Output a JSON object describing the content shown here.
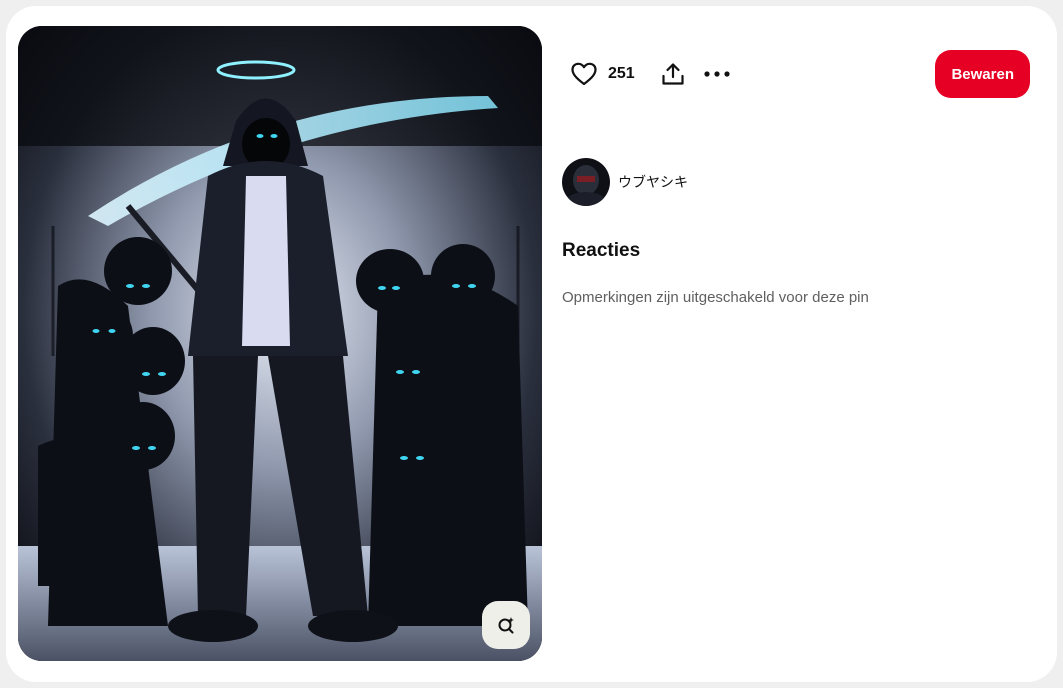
{
  "pin": {
    "like_count": "251",
    "save_label": "Bewaren",
    "author_name": "ウブヤシキ",
    "image_alt": "Dark anime artwork of a hooded reaper with a halo and scythe surrounded by shadow creatures with glowing blue eyes"
  },
  "comments": {
    "heading": "Reacties",
    "disabled_message": "Opmerkingen zijn uitgeschakeld voor deze pin"
  },
  "icons": {
    "like": "heart-icon",
    "share": "share-icon",
    "more": "more-dots-icon",
    "visual_search": "visual-search-icon"
  },
  "colors": {
    "save_button": "#e60023",
    "eye_glow": "#3fd4f0",
    "background": "#ffffff"
  }
}
